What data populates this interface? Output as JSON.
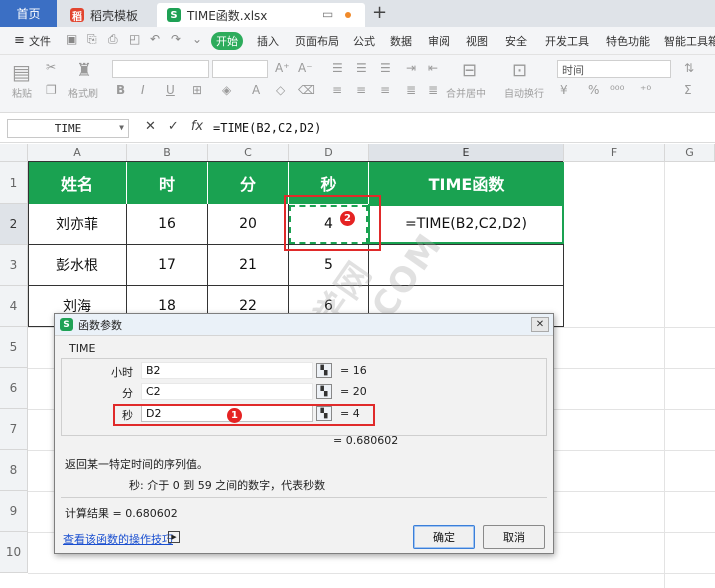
{
  "tabs": {
    "home": "首页",
    "template": "稻壳模板",
    "file": "TIME函数.xlsx",
    "new_tab": "+"
  },
  "menu": {
    "file": "文件",
    "items": [
      "开始",
      "插入",
      "页面布局",
      "公式",
      "数据",
      "审阅",
      "视图",
      "安全",
      "开发工具",
      "特色功能",
      "智能工具箱"
    ]
  },
  "ribbon": {
    "paste": "粘贴",
    "format_painter": "格式刷",
    "merge_center": "合并居中",
    "auto_wrap": "自动换行",
    "number_format": "时间"
  },
  "formula_bar": {
    "name_box": "TIME",
    "formula": "=TIME(B2,C2,D2)",
    "fx": "fx"
  },
  "columns": [
    "A",
    "B",
    "C",
    "D",
    "E",
    "F",
    "G"
  ],
  "rows": [
    "1",
    "2",
    "3",
    "4",
    "5",
    "6",
    "7",
    "8",
    "9",
    "10"
  ],
  "table": {
    "headers": [
      "姓名",
      "时",
      "分",
      "秒",
      "TIME函数"
    ],
    "rows": [
      [
        "刘亦菲",
        "16",
        "20",
        "4",
        "=TIME(B2,C2,D2)"
      ],
      [
        "彭水根",
        "17",
        "21",
        "5",
        ""
      ],
      [
        "刘海",
        "18",
        "22",
        "6",
        ""
      ]
    ]
  },
  "badges": {
    "one": "1",
    "two": "2"
  },
  "watermark": "软件自学网 RJZXW.COM",
  "dialog": {
    "title": "函数参数",
    "function_name": "TIME",
    "args": [
      {
        "label": "小时",
        "value": "B2",
        "result": "= 16"
      },
      {
        "label": "分",
        "value": "C2",
        "result": "= 20"
      },
      {
        "label": "秒",
        "value": "D2",
        "result": "= 4"
      }
    ],
    "formula_result": "= 0.680602",
    "description": "返回某一特定时间的序列值。",
    "arg_help": "秒:   介于 0 到 59 之间的数字，代表秒数",
    "calc_result": "计算结果 =  0.680602",
    "help_link": "查看该函数的操作技巧",
    "ok": "确定",
    "cancel": "取消"
  },
  "colors": {
    "header_green": "#1aa251",
    "accent_blue": "#3b6fc4",
    "highlight_red": "#e02a2a"
  }
}
